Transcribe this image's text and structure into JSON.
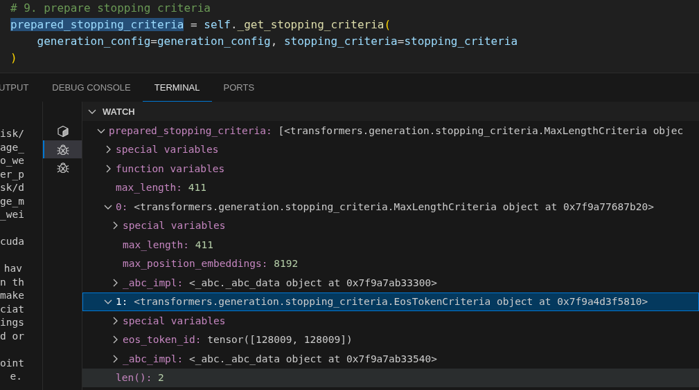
{
  "editor": {
    "lines": [
      [
        {
          "text": "# 9. prepare stopping criteria",
          "kind": "comment",
          "highlighted": false
        }
      ],
      [
        {
          "text": "prepared_stopping_criteria",
          "kind": "variable",
          "highlighted": true
        },
        {
          "text": " = ",
          "kind": "plain",
          "highlighted": false
        },
        {
          "text": "self",
          "kind": "variable",
          "highlighted": false
        },
        {
          "text": ".",
          "kind": "plain",
          "highlighted": false
        },
        {
          "text": "_get_stopping_criteria",
          "kind": "function",
          "highlighted": false
        },
        {
          "text": "(",
          "kind": "bracket",
          "highlighted": false
        }
      ],
      [
        {
          "text": "    generation_config",
          "kind": "variable",
          "highlighted": false
        },
        {
          "text": "=",
          "kind": "plain",
          "highlighted": false
        },
        {
          "text": "generation_config",
          "kind": "variable",
          "highlighted": false
        },
        {
          "text": ", ",
          "kind": "plain",
          "highlighted": false
        },
        {
          "text": "stopping_criteria",
          "kind": "variable",
          "highlighted": false
        },
        {
          "text": "=",
          "kind": "plain",
          "highlighted": false
        },
        {
          "text": "stopping_criteria",
          "kind": "variable",
          "highlighted": false
        }
      ],
      [
        {
          "text": ")",
          "kind": "bracket",
          "highlighted": false
        }
      ]
    ]
  },
  "panel_tabs": [
    {
      "label": "UTPUT",
      "selected": false
    },
    {
      "label": "DEBUG CONSOLE",
      "selected": false
    },
    {
      "label": "TERMINAL",
      "selected": true
    },
    {
      "label": "PORTS",
      "selected": false
    }
  ],
  "terminal": {
    "paragraphs": [
      [
        "isk/",
        "age_",
        "o_we",
        "er_p",
        "sk/d",
        "ge_m",
        "_wei"
      ],
      [
        "cuda"
      ],
      [
        "hav",
        "n th",
        "make",
        "ciat",
        "ings",
        "d or"
      ],
      [
        "oint",
        "e."
      ]
    ]
  },
  "terminal_list": [
    {
      "kind": "box",
      "selected": false
    },
    {
      "kind": "bug",
      "selected": true
    },
    {
      "kind": "bug",
      "selected": false
    }
  ],
  "watch": {
    "title": "WATCH",
    "expanded": true,
    "items": [
      {
        "name": "prepared_stopping_criteria:",
        "value": "[<transformers.generation.stopping_criteria.MaxLengthCriteria objec",
        "kind": "object",
        "expandable": true,
        "expanded": true,
        "selected": false,
        "hovered": false,
        "children": [
          {
            "name": "special variables",
            "expandable": true,
            "expanded": false,
            "selected": false,
            "hovered": false
          },
          {
            "name": "function variables",
            "expandable": true,
            "expanded": false,
            "selected": false,
            "hovered": false
          },
          {
            "name": "max_length:",
            "value": "411",
            "kind": "number",
            "expandable": false,
            "expanded": false,
            "selected": false,
            "hovered": false
          },
          {
            "name": "0:",
            "value": "<transformers.generation.stopping_criteria.MaxLengthCriteria object at 0x7f9a77687b20>",
            "kind": "object",
            "expandable": true,
            "expanded": true,
            "selected": false,
            "hovered": false,
            "children": [
              {
                "name": "special variables",
                "expandable": true,
                "expanded": false,
                "selected": false,
                "hovered": false
              },
              {
                "name": "max_length:",
                "value": "411",
                "kind": "number",
                "expandable": false,
                "expanded": false,
                "selected": false,
                "hovered": false
              },
              {
                "name": "max_position_embeddings:",
                "value": "8192",
                "kind": "number",
                "expandable": false,
                "expanded": false,
                "selected": false,
                "hovered": false
              },
              {
                "name": "_abc_impl:",
                "value": "<_abc._abc_data object at 0x7f9a7ab33300>",
                "kind": "object",
                "expandable": true,
                "expanded": false,
                "selected": false,
                "hovered": false
              }
            ]
          },
          {
            "name": "1:",
            "value": "<transformers.generation.stopping_criteria.EosTokenCriteria object at 0x7f9a4d3f5810>",
            "kind": "object",
            "expandable": true,
            "expanded": true,
            "selected": true,
            "hovered": false,
            "children": [
              {
                "name": "special variables",
                "expandable": true,
                "expanded": false,
                "selected": false,
                "hovered": false
              },
              {
                "name": "eos_token_id:",
                "value": "tensor([128009, 128009])",
                "kind": "object",
                "expandable": true,
                "expanded": false,
                "selected": false,
                "hovered": false
              },
              {
                "name": "_abc_impl:",
                "value": "<_abc._abc_data object at 0x7f9a7ab33540>",
                "kind": "object",
                "expandable": true,
                "expanded": false,
                "selected": false,
                "hovered": false
              }
            ]
          },
          {
            "name": "len():",
            "value": "2",
            "kind": "number",
            "expandable": false,
            "expanded": false,
            "selected": false,
            "hovered": true
          }
        ]
      }
    ]
  }
}
